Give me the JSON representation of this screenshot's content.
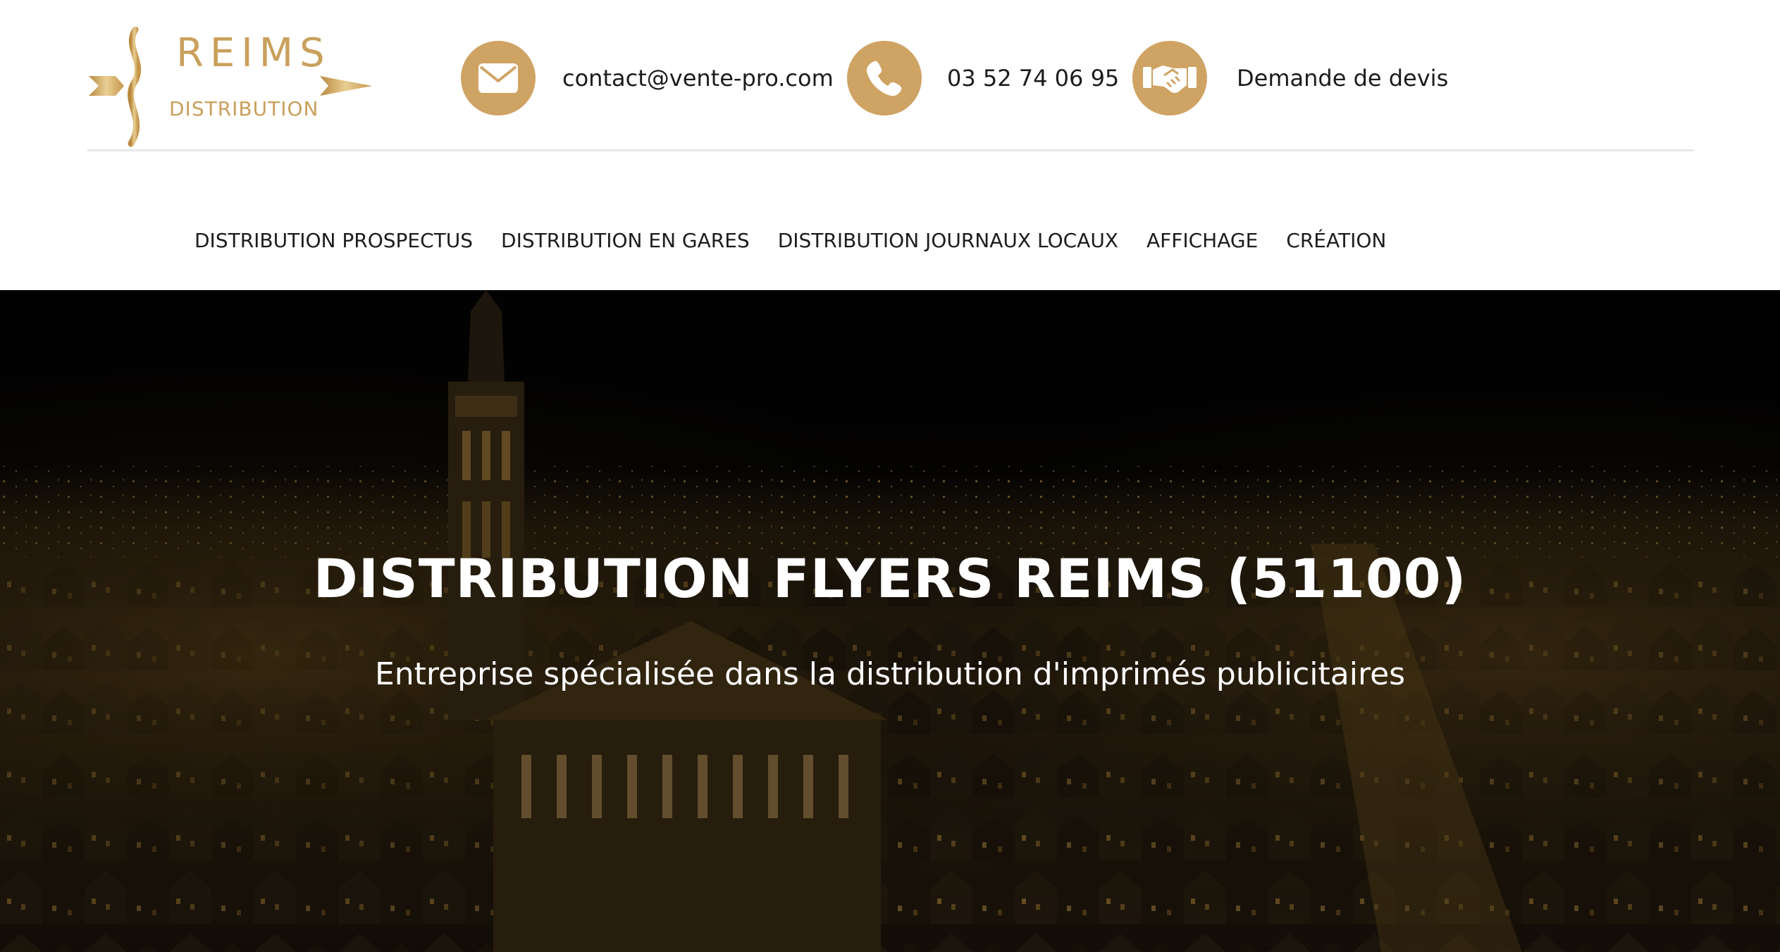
{
  "brand": {
    "logo_line1": "REIMS",
    "logo_line2": "DISTRIBUTION",
    "accent_color": "#cfa363"
  },
  "contacts": {
    "email": {
      "icon": "envelope-icon",
      "text": "contact@vente-pro.com"
    },
    "phone": {
      "icon": "phone-icon",
      "text": "03 52 74 06 95"
    },
    "quote": {
      "icon": "handshake-icon",
      "text": "Demande de devis"
    }
  },
  "nav": {
    "items": [
      {
        "label": "DISTRIBUTION PROSPECTUS"
      },
      {
        "label": "DISTRIBUTION EN GARES"
      },
      {
        "label": "DISTRIBUTION JOURNAUX LOCAUX"
      },
      {
        "label": "AFFICHAGE"
      },
      {
        "label": "CRÉATION"
      }
    ]
  },
  "hero": {
    "title": "DISTRIBUTION FLYERS REIMS (51100)",
    "subtitle": "Entreprise spécialisée dans la distribution d'imprimés publicitaires",
    "background": "night-city-skyline-image"
  }
}
